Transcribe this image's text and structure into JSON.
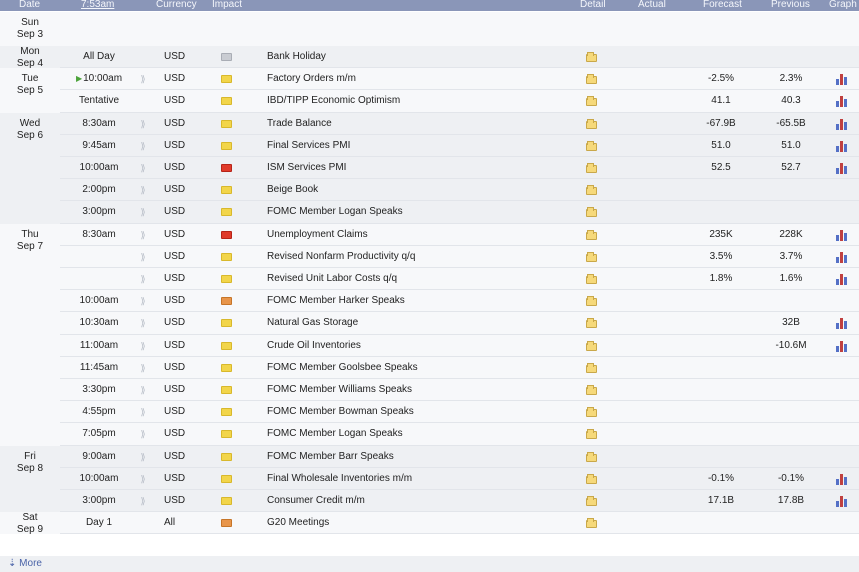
{
  "header": {
    "date": "Date",
    "time": "7:53am",
    "currency": "Currency",
    "impact": "Impact",
    "detail": "Detail",
    "actual": "Actual",
    "forecast": "Forecast",
    "previous": "Previous",
    "graph": "Graph"
  },
  "days": [
    {
      "dow": "Sun",
      "date": "Sep 3",
      "events": []
    },
    {
      "dow": "Mon",
      "date": "Sep 4",
      "events": [
        {
          "time": "All Day",
          "currency": "USD",
          "impact": "grey",
          "event": "Bank Holiday",
          "forecast": "",
          "previous": "",
          "graph": false
        }
      ]
    },
    {
      "dow": "Tue",
      "date": "Sep 5",
      "events": [
        {
          "time": "10:00am",
          "current": true,
          "currency": "USD",
          "impact": "yellow",
          "event": "Factory Orders m/m",
          "forecast": "-2.5%",
          "previous": "2.3%",
          "graph": true
        },
        {
          "time": "Tentative",
          "currency": "USD",
          "impact": "yellow",
          "event": "IBD/TIPP Economic Optimism",
          "forecast": "41.1",
          "previous": "40.3",
          "graph": true
        }
      ]
    },
    {
      "dow": "Wed",
      "date": "Sep 6",
      "events": [
        {
          "time": "8:30am",
          "currency": "USD",
          "impact": "yellow",
          "event": "Trade Balance",
          "forecast": "-67.9B",
          "previous": "-65.5B",
          "graph": true
        },
        {
          "time": "9:45am",
          "currency": "USD",
          "impact": "yellow",
          "event": "Final Services PMI",
          "forecast": "51.0",
          "previous": "51.0",
          "graph": true
        },
        {
          "time": "10:00am",
          "currency": "USD",
          "impact": "red",
          "event": "ISM Services PMI",
          "forecast": "52.5",
          "previous": "52.7",
          "graph": true
        },
        {
          "time": "2:00pm",
          "currency": "USD",
          "impact": "yellow",
          "event": "Beige Book",
          "forecast": "",
          "previous": "",
          "graph": false
        },
        {
          "time": "3:00pm",
          "currency": "USD",
          "impact": "yellow",
          "event": "FOMC Member Logan Speaks",
          "forecast": "",
          "previous": "",
          "graph": false
        }
      ]
    },
    {
      "dow": "Thu",
      "date": "Sep 7",
      "events": [
        {
          "time": "8:30am",
          "currency": "USD",
          "impact": "red",
          "event": "Unemployment Claims",
          "forecast": "235K",
          "previous": "228K",
          "graph": true
        },
        {
          "time": "",
          "currency": "USD",
          "impact": "yellow",
          "event": "Revised Nonfarm Productivity q/q",
          "forecast": "3.5%",
          "previous": "3.7%",
          "graph": true
        },
        {
          "time": "",
          "currency": "USD",
          "impact": "yellow",
          "event": "Revised Unit Labor Costs q/q",
          "forecast": "1.8%",
          "previous": "1.6%",
          "graph": true
        },
        {
          "time": "10:00am",
          "currency": "USD",
          "impact": "orange",
          "event": "FOMC Member Harker Speaks",
          "forecast": "",
          "previous": "",
          "graph": false
        },
        {
          "time": "10:30am",
          "currency": "USD",
          "impact": "yellow",
          "event": "Natural Gas Storage",
          "forecast": "",
          "previous": "32B",
          "graph": true
        },
        {
          "time": "11:00am",
          "currency": "USD",
          "impact": "yellow",
          "event": "Crude Oil Inventories",
          "forecast": "",
          "previous": "-10.6M",
          "graph": true
        },
        {
          "time": "11:45am",
          "currency": "USD",
          "impact": "yellow",
          "event": "FOMC Member Goolsbee Speaks",
          "forecast": "",
          "previous": "",
          "graph": false
        },
        {
          "time": "3:30pm",
          "currency": "USD",
          "impact": "yellow",
          "event": "FOMC Member Williams Speaks",
          "forecast": "",
          "previous": "",
          "graph": false
        },
        {
          "time": "4:55pm",
          "currency": "USD",
          "impact": "yellow",
          "event": "FOMC Member Bowman Speaks",
          "forecast": "",
          "previous": "",
          "graph": false
        },
        {
          "time": "7:05pm",
          "currency": "USD",
          "impact": "yellow",
          "event": "FOMC Member Logan Speaks",
          "forecast": "",
          "previous": "",
          "graph": false
        }
      ]
    },
    {
      "dow": "Fri",
      "date": "Sep 8",
      "events": [
        {
          "time": "9:00am",
          "currency": "USD",
          "impact": "yellow",
          "event": "FOMC Member Barr Speaks",
          "forecast": "",
          "previous": "",
          "graph": false
        },
        {
          "time": "10:00am",
          "currency": "USD",
          "impact": "yellow",
          "event": "Final Wholesale Inventories m/m",
          "forecast": "-0.1%",
          "previous": "-0.1%",
          "graph": true
        },
        {
          "time": "3:00pm",
          "currency": "USD",
          "impact": "yellow",
          "event": "Consumer Credit m/m",
          "forecast": "17.1B",
          "previous": "17.8B",
          "graph": true
        }
      ]
    },
    {
      "dow": "Sat",
      "date": "Sep 9",
      "events": [
        {
          "time": "Day 1",
          "currency": "All",
          "impact": "orange",
          "event": "G20 Meetings",
          "forecast": "",
          "previous": "",
          "graph": false
        }
      ]
    }
  ],
  "footer": {
    "more": "More",
    "more_icon": "arrow-down-icon"
  },
  "colors": {
    "header_bg": "#8a96b8",
    "impact_red": "#e03a2a",
    "impact_orange": "#e8954a",
    "impact_yellow": "#f2d54a",
    "impact_grey": "#c9ccd2"
  }
}
